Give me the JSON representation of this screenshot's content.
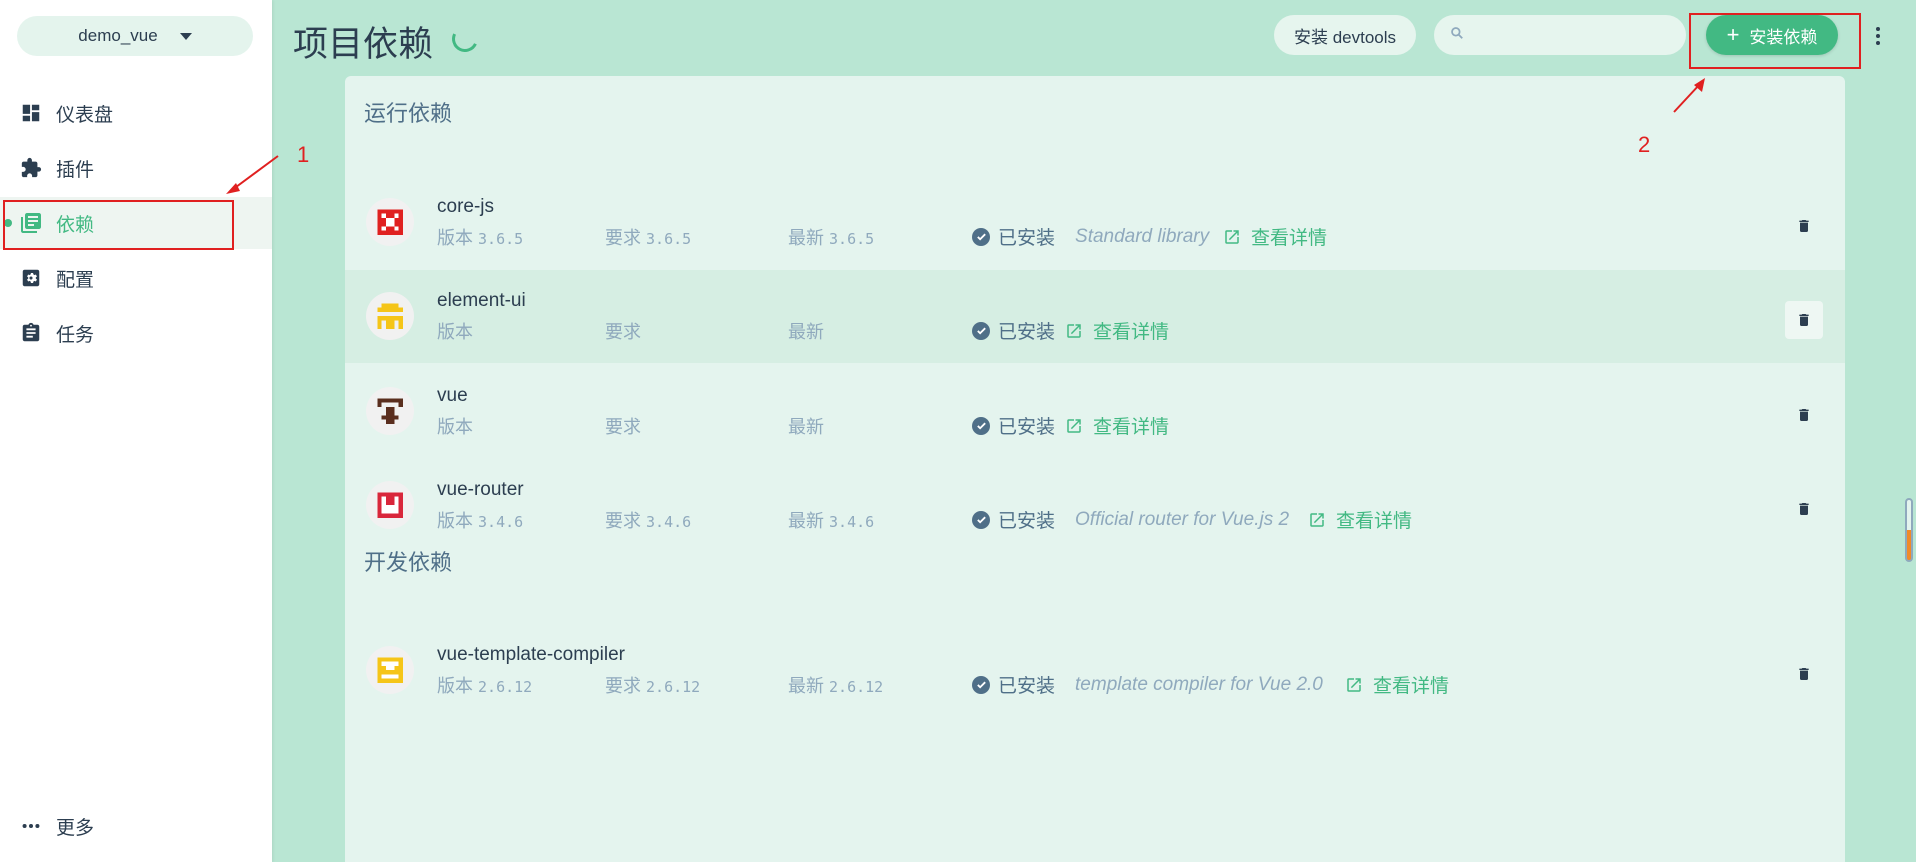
{
  "sidebar": {
    "project": "demo_vue",
    "items": [
      {
        "label": "仪表盘",
        "icon": "dashboard-icon"
      },
      {
        "label": "插件",
        "icon": "puzzle-icon"
      },
      {
        "label": "依赖",
        "icon": "library-icon"
      },
      {
        "label": "配置",
        "icon": "settings-icon"
      },
      {
        "label": "任务",
        "icon": "clipboard-icon"
      }
    ],
    "more": "更多"
  },
  "header": {
    "title": "项目依赖",
    "devtools_label": "安装 devtools",
    "search_placeholder": "",
    "install_label": "安装依赖"
  },
  "sections": {
    "runtime": "运行依赖",
    "dev": "开发依赖"
  },
  "labels": {
    "version": "版本",
    "required": "要求",
    "latest": "最新",
    "installed": "已安装",
    "details": "查看详情"
  },
  "deps": [
    {
      "name": "core-js",
      "version": "3.6.5",
      "required": "3.6.5",
      "latest": "3.6.5",
      "description": "Standard library"
    },
    {
      "name": "element-ui",
      "version": "",
      "required": "",
      "latest": "",
      "description": ""
    },
    {
      "name": "vue",
      "version": "",
      "required": "",
      "latest": "",
      "description": ""
    },
    {
      "name": "vue-router",
      "version": "3.4.6",
      "required": "3.4.6",
      "latest": "3.4.6",
      "description": "Official router for Vue.js 2"
    },
    {
      "name": "vue-template-compiler",
      "version": "2.6.12",
      "required": "2.6.12",
      "latest": "2.6.12",
      "description": "template compiler for Vue 2.0"
    }
  ],
  "annotations": {
    "one": "1",
    "two": "2"
  },
  "colors": {
    "accent": "#42b983",
    "text": "#2c3e50",
    "muted": "#8fa9bd",
    "annotation": "#e02020",
    "background": "#b9e6d3"
  }
}
